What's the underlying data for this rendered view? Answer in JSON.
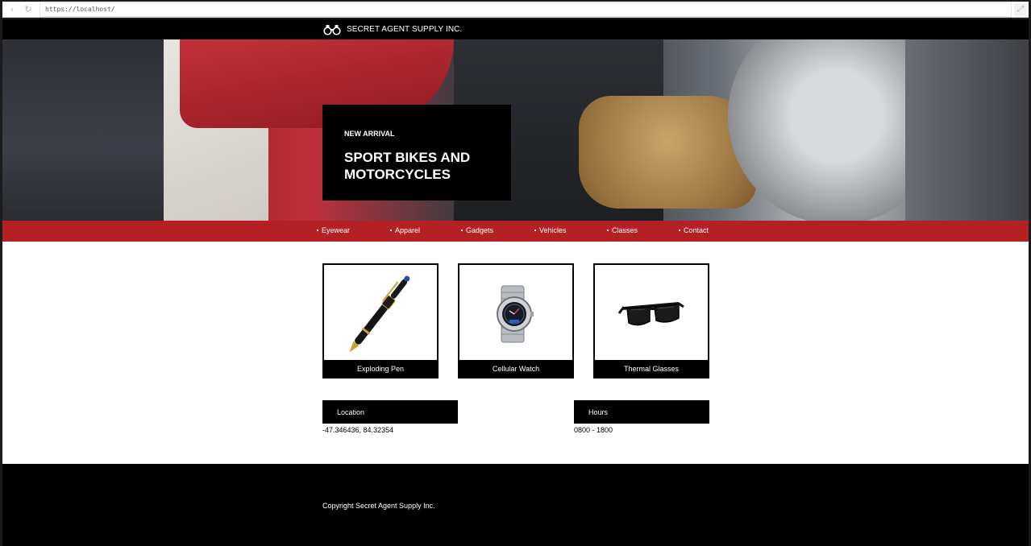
{
  "browser": {
    "url": "https://localhost/",
    "back_icon": "back-arrow-icon",
    "reload_icon": "reload-icon",
    "expand_icon": "expand-icon"
  },
  "header": {
    "brand": "SECRET AGENT SUPPLY INC.",
    "logo_icon": "binoculars-icon"
  },
  "hero": {
    "kicker": "NEW ARRIVAL",
    "title": "SPORT BIKES AND MOTORCYCLES"
  },
  "nav": {
    "items": [
      {
        "label": "Eyewear"
      },
      {
        "label": "Apparel"
      },
      {
        "label": "Gadgets"
      },
      {
        "label": "Vehicles"
      },
      {
        "label": "Classes"
      },
      {
        "label": "Contact"
      }
    ]
  },
  "products": [
    {
      "name": "Exploding Pen",
      "icon": "pen-icon"
    },
    {
      "name": "Cellular Watch",
      "icon": "watch-icon"
    },
    {
      "name": "Thermal Glasses",
      "icon": "glasses-icon"
    }
  ],
  "info": {
    "location": {
      "heading": "Location",
      "value": "-47.346436, 84.32354"
    },
    "hours": {
      "heading": "Hours",
      "value": "0800 - 1800"
    }
  },
  "footer": {
    "copyright": "Copyright Secret Agent Supply Inc."
  },
  "colors": {
    "nav_red": "#b52024",
    "black": "#000000",
    "white": "#ffffff"
  }
}
